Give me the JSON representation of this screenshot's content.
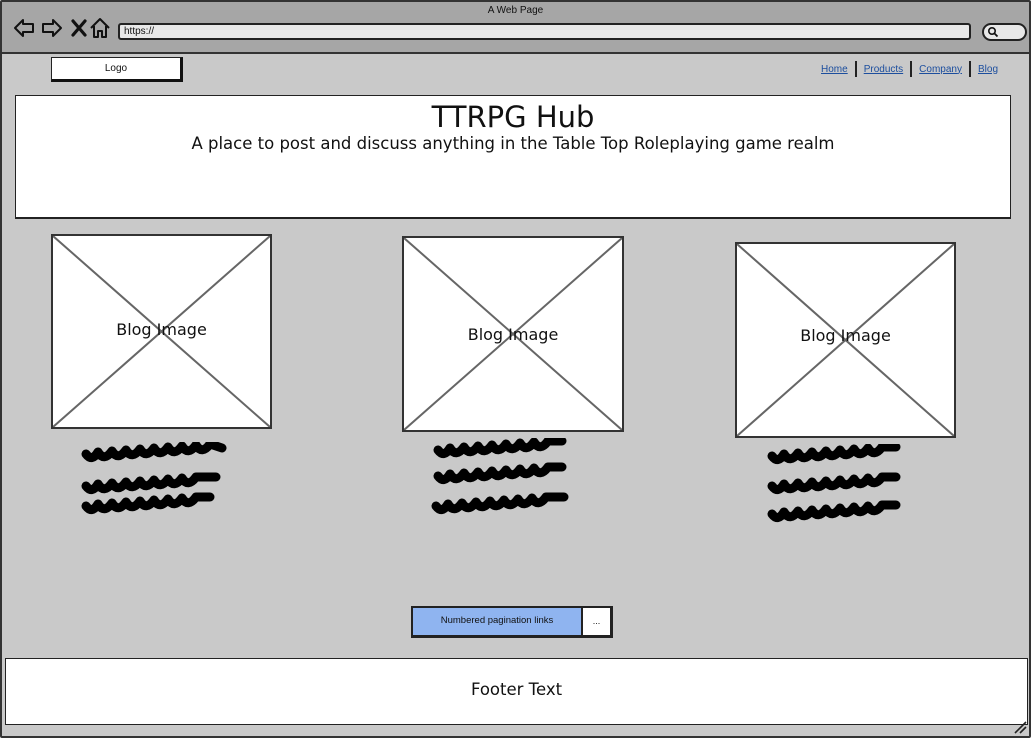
{
  "browser": {
    "title": "A Web Page",
    "url": "https://",
    "icons": [
      "back-icon",
      "forward-icon",
      "close-icon",
      "home-icon",
      "search-icon"
    ]
  },
  "header": {
    "logo_label": "Logo",
    "nav": [
      {
        "label": "Home"
      },
      {
        "label": "Products"
      },
      {
        "label": "Company"
      },
      {
        "label": "Blog"
      }
    ]
  },
  "hero": {
    "title": "TTRPG Hub",
    "subtitle": "A place to post and discuss anything in the Table Top Roleplaying game realm"
  },
  "blog_cards": [
    {
      "image_label": "Blog Image"
    },
    {
      "image_label": "Blog Image"
    },
    {
      "image_label": "Blog Image"
    }
  ],
  "pagination": {
    "label": "Numbered pagination links",
    "more_label": "..."
  },
  "footer": {
    "text": "Footer Text"
  },
  "colors": {
    "window_bg": "#c9c9c9",
    "titlebar_bg": "#a6a6a6",
    "link": "#1c4e9e",
    "pagination_fill": "#8fb4f0"
  }
}
